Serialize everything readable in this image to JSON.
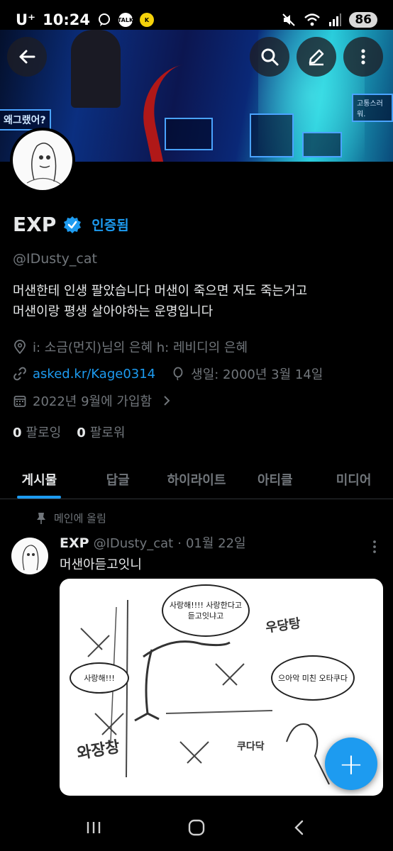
{
  "status_bar": {
    "carrier": "U⁺",
    "time": "10:24",
    "battery": "86",
    "notif_talk": "TALK",
    "notif_app": "K"
  },
  "header": {
    "back_icon": "arrow-left-icon",
    "search_icon": "search-icon",
    "compose_icon": "pencil-icon",
    "more_icon": "more-vertical-icon"
  },
  "banner": {
    "sign_left": "왜그랬어?",
    "sign_right": "고통스러워."
  },
  "profile": {
    "name": "EXP",
    "verified_label": "인증됨",
    "handle": "@IDusty_cat",
    "bio_line1": "머샌한테 인생 팔았습니다 머샌이 죽으면 저도 죽는거고",
    "bio_line2": "머샌이랑 평생 살아야하는 운명입니다",
    "location": "i: 소금(먼지)님의 은혜 h: 레비디의 은혜",
    "website": "asked.kr/Kage0314",
    "birthday": "생일: 2000년 3월 14일",
    "joined": "2022년 9월에 가입함",
    "following_count": "0",
    "following_label": "팔로잉",
    "followers_count": "0",
    "followers_label": "팔로워"
  },
  "tabs": [
    {
      "label": "게시물",
      "active": true
    },
    {
      "label": "답글",
      "active": false
    },
    {
      "label": "하이라이트",
      "active": false
    },
    {
      "label": "아티클",
      "active": false
    },
    {
      "label": "미디어",
      "active": false
    }
  ],
  "post": {
    "pinned_label": "메인에 올림",
    "author": "EXP",
    "handle": "@IDusty_cat",
    "separator": "·",
    "date": "01월 22일",
    "text": "머샌아듣고잇니",
    "image_bubble1": "사랑해!!!! 사랑한다고 듣고잇냐고",
    "image_bubble2": "사랑해!!!",
    "image_bubble3": "으아악 미친 오타쿠다",
    "image_sfx1": "우당탕",
    "image_sfx2": "와장창",
    "image_sfx3": "쿠다닥"
  },
  "fab": {
    "label": "+"
  },
  "colors": {
    "accent": "#1d9bf0",
    "background": "#000000",
    "muted": "#71767b",
    "text": "#e7e9ea"
  }
}
